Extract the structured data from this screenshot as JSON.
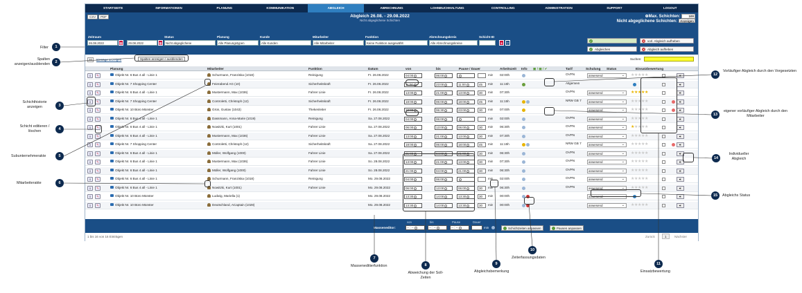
{
  "nav": {
    "items": [
      "STARTSEITE",
      "INFORMATIONEN",
      "PLANUNG",
      "KOMMUNIKATION",
      "ABGLEICH",
      "ABRECHNUNG",
      "LOHNBUCHHALTUNG",
      "CONTROLLING",
      "ADMINISTRATION",
      "SUPPORT",
      "LOGOUT"
    ],
    "active": "ABGLEICH"
  },
  "header": {
    "csv": "CSV",
    "pdf": "PDF",
    "title": "Abgleich 26.08. - 29.08.2022",
    "subtitle": "Nicht abgeglichene Schichten",
    "max_label": "Max. Schichten:",
    "max_value": "100",
    "open_label": "Nicht abgeglichene Schichten:",
    "open_btn": "Anzeigen"
  },
  "filters": {
    "labels": {
      "zeitraum": "Zeitraum",
      "status": "Status",
      "planung": "Planung",
      "kunde": "Kunde",
      "mitarbeiter": "Mitarbeiter",
      "funktion": "Funktion",
      "kreis": "Abrechnungskreis",
      "schicht_id": "Schicht-ID"
    },
    "date_from": "26.08.2022",
    "date_to": "29.08.2022",
    "status": "Nicht abgeglichene",
    "planung": "Alle Planungstypen",
    "kunde": "Alle Kunden",
    "mitarbeiter": "Alle Mitarbeiter",
    "funktion": "Keine Funktion ausgewählt",
    "kreis": "Alle Abrechnungskreise"
  },
  "actions": {
    "remove_prelim": "vorl. Abgleich aufheben",
    "confirm": "Abgleichen",
    "remove": "Abgleich aufheben"
  },
  "toolbar": {
    "entries": "20",
    "entries_label": "Einträge anzeigen",
    "columns_btn": "Spalten anzeigen / ausblenden",
    "search_label": "Suchen:"
  },
  "columns": {
    "planung": "Planung",
    "mitarbeiter": "Mitarbeiter",
    "funktion": "Funktion",
    "datum": "Datum",
    "von": "von",
    "bis": "bis",
    "pause": "Pause / Dauer",
    "az": "Arbeitszeit",
    "info": "Info",
    "tarif": "Tarif",
    "schulung": "Schulung",
    "status": "Status",
    "bewertung": "Einsatzbewertung"
  },
  "rows": [
    {
      "obj": "Objekt Nr. 6 Bus 4 all - Linie 1",
      "ma": "Schurmann, Franziska (1018)",
      "fn": "Reinigung",
      "dt": "Fr. 26.08.2022",
      "von": "04:00",
      "bis": "06:00",
      "pv": "",
      "pd": "",
      "az": "02:00h",
      "info": [
        "#9bb6d6"
      ],
      "tarif": "ÖVPN",
      "status": "anwesend",
      "stars": 0,
      "extra": ""
    },
    {
      "obj": "Objekt Nr. 7 Shopping Center",
      "ma": "Feierabend AG (10)",
      "fn": "Sicherheitskraft",
      "dt": "Fr. 26.08.2022",
      "von": "11:00",
      "bis": "23:00",
      "pv": "11:00",
      "pd": "45",
      "az": "11:15h",
      "info": [
        "#6a9e3d"
      ],
      "tarif": "Allgemein",
      "status": "",
      "stars": -1,
      "extra": "blue"
    },
    {
      "obj": "Objekt Nr. 6 Bus 4 all - Linie 1",
      "ma": "Mustermann, Max (1036)",
      "fn": "Fahrer Linie",
      "dt": "Fr. 26.08.2022",
      "von": "13:00",
      "bis": "21:00",
      "pv": "13:00",
      "pd": "30",
      "az": "07:30h",
      "info": [],
      "tarif": "ÖVPN",
      "status": "anwesend",
      "stars": 5,
      "extra": ""
    },
    {
      "obj": "Objekt Nr. 7 Shopping Center",
      "ma": "Controletti, Christoph (12)",
      "fn": "Sicherheitskraft",
      "dt": "Fr. 26.08.2022",
      "von": "18:00",
      "bis": "06:00",
      "pv": "18:00",
      "pd": "45",
      "az": "11:15h",
      "info": [
        "#e8b400",
        "#9bb6d6"
      ],
      "tarif": "NRW GB 7",
      "status": "anwesend",
      "stars": 0,
      "extra": "red"
    },
    {
      "obj": "Objekt Nr. 10 Büro Münster",
      "ma": "Grün, Gustav (1043)",
      "fn": "Thekenleiter",
      "dt": "Fr. 26.08.2022",
      "von": "23:00",
      "bis": "06:30",
      "pv": "23:00",
      "pd": "30",
      "az": "07:00h",
      "info": [
        "#e8b400"
      ],
      "tarif": "",
      "status": "anwesend",
      "stars": 0,
      "extra": "red"
    },
    {
      "obj": "Objekt Nr. 6 Bus 4 all - Linie 1",
      "ma": "Dassmann, Anna-Marie (1019)",
      "fn": "Reinigung",
      "dt": "Sa. 27.08.2022",
      "von": "04:00",
      "bis": "06:00",
      "pv": "",
      "pd": "",
      "az": "02:00h",
      "info": [
        "#9bb6d6"
      ],
      "tarif": "ÖVPN",
      "status": "anwesend",
      "stars": 0,
      "extra": ""
    },
    {
      "obj": "Objekt Nr. 6 Bus 4 all - Linie 1",
      "ma": "Nowitzki, Kurt (1001)",
      "fn": "Fahrer Linie",
      "dt": "Sa. 27.08.2022",
      "von": "06:00",
      "bis": "13:00",
      "pv": "06:00",
      "pd": "30",
      "az": "06:30h",
      "info": [
        "#9bb6d6"
      ],
      "tarif": "ÖVPN",
      "status": "anwesend",
      "stars": 1,
      "extra": ""
    },
    {
      "obj": "Objekt Nr. 6 Bus 4 all - Linie 1",
      "ma": "Mustermann, Max (1036)",
      "fn": "Fahrer Linie",
      "dt": "Sa. 27.08.2022",
      "von": "13:00",
      "bis": "21:00",
      "pv": "13:00",
      "pd": "30",
      "az": "07:30h",
      "info": [
        "#9bb6d6"
      ],
      "tarif": "ÖVPN",
      "status": "anwesend",
      "stars": 0,
      "extra": ""
    },
    {
      "obj": "Objekt Nr. 7 Shopping Center",
      "ma": "Controletti, Christoph (12)",
      "fn": "Sicherheitskraft",
      "dt": "Sa. 27.08.2022",
      "von": "18:00",
      "bis": "06:00",
      "pv": "18:00",
      "pd": "45",
      "az": "11:15h",
      "info": [
        "#e8b400",
        "#9bb6d6"
      ],
      "tarif": "NRW GB 7",
      "status": "anwesend",
      "stars": 0,
      "extra": "red"
    },
    {
      "obj": "Objekt Nr. 6 Bus 4 all - Linie 1",
      "ma": "Müller, Wolfgang (1000)",
      "fn": "Fahrer Linie",
      "dt": "Sa. 27.08.2022",
      "von": "21:00",
      "bis": "04:00",
      "pv": "21:00",
      "pd": "30",
      "az": "06:30h",
      "info": [
        "#9bb6d6"
      ],
      "tarif": "ÖVPN",
      "status": "anwesend",
      "stars": 0,
      "extra": ""
    },
    {
      "obj": "Objekt Nr. 6 Bus 4 all - Linie 1",
      "ma": "Mustermann, Max (1036)",
      "fn": "Fahrer Linie",
      "dt": "So. 28.08.2022",
      "von": "13:00",
      "bis": "21:00",
      "pv": "13:00",
      "pd": "30",
      "az": "07:30h",
      "info": [
        "#9bb6d6"
      ],
      "tarif": "ÖVPN",
      "status": "anwesend",
      "stars": 0,
      "extra": ""
    },
    {
      "obj": "Objekt Nr. 6 Bus 4 all - Linie 1",
      "ma": "Müller, Wolfgang (1000)",
      "fn": "Fahrer Linie",
      "dt": "So. 28.08.2022",
      "von": "21:00",
      "bis": "04:00",
      "pv": "21:00",
      "pd": "30",
      "az": "06:30h",
      "info": [
        "#9bb6d6"
      ],
      "tarif": "ÖVPN",
      "status": "anwesend",
      "stars": 0,
      "extra": ""
    },
    {
      "obj": "Objekt Nr. 6 Bus 4 all - Linie 1",
      "ma": "Schurmann, Franziska (1018)",
      "fn": "Reinigung",
      "dt": "Mo. 29.08.2022",
      "von": "04:00",
      "bis": "06:00",
      "pv": "",
      "pd": "",
      "az": "02:00h",
      "info": [
        "#9bb6d6"
      ],
      "tarif": "ÖVPN",
      "status": "anwesend",
      "stars": 0,
      "extra": ""
    },
    {
      "obj": "Objekt Nr. 6 Bus 4 all - Linie 1",
      "ma": "Nowitzki, Kurt (1001)",
      "fn": "Fahrer Linie",
      "dt": "Mo. 29.08.2022",
      "von": "06:00",
      "bis": "13:00",
      "pv": "06:00",
      "pd": "30",
      "az": "06:30h",
      "info": [
        "#9bb6d6"
      ],
      "tarif": "ÖVPN",
      "status": "anwesend",
      "stars": 0,
      "extra": ""
    },
    {
      "obj": "Objekt Nr. 10 Büro Münster",
      "ma": "Ludwig, Mariella (1)",
      "fn": "",
      "dt": "Mo. 29.08.2022",
      "von": "13:30",
      "bis": "14:00",
      "pv": "13:30",
      "pd": "30",
      "az": "00:00h",
      "info": [
        "#9bb6d6",
        "#c33"
      ],
      "tarif": "",
      "status": "anwesend",
      "stars": -1,
      "extra": "blue"
    },
    {
      "obj": "Objekt Nr. 10 Büro Münster",
      "ma": "Deutschland, ACaptain (1028)",
      "fn": "",
      "dt": "Mo. 29.08.2022",
      "von": "13:30",
      "bis": "14:00",
      "pv": "13:30",
      "pd": "30",
      "az": "00:00h",
      "info": [
        "#9bb6d6",
        "#c33"
      ],
      "tarif": "",
      "status": "anwesend",
      "stars": 0,
      "extra": ""
    }
  ],
  "mass": {
    "label": "Masseneditor:",
    "von": "von",
    "bis": "bis",
    "pause": "Pause",
    "dauer": "Dauer",
    "min": "min",
    "btn1": "Schichtzeiten anpassen",
    "btn2": "Pausen anpassen"
  },
  "footer": {
    "info": "1 bis 16 von 16 Einträgen",
    "prev": "Zurück",
    "page": "1",
    "next": "Nächster"
  },
  "callouts": [
    {
      "n": "1",
      "label": "Filter"
    },
    {
      "n": "2",
      "label": "Spalten anzeigen/ausblenden"
    },
    {
      "n": "3",
      "label": "Schichthistorie anzeigen"
    },
    {
      "n": "4",
      "label": "Schicht editieren / löschen"
    },
    {
      "n": "5",
      "label": "Subunternehmerakte"
    },
    {
      "n": "6",
      "label": "Mitarbeiterakte"
    },
    {
      "n": "7",
      "label": "Masseneditierfunktion"
    },
    {
      "n": "8",
      "label": "Abweichung der Soll- Zeiten"
    },
    {
      "n": "9",
      "label": "Abgleichsbemerkung"
    },
    {
      "n": "10",
      "label": "Zeiterfassungsdaten"
    },
    {
      "n": "11",
      "label": "Einsatzbewertung"
    },
    {
      "n": "12",
      "label": "Vorläufiger Abgleich durch den Vorgesetzten"
    },
    {
      "n": "13",
      "label": "eigener vorläufiger Abgleich durch den Mitarbeiter"
    },
    {
      "n": "14",
      "label": "Individueller Abgleich"
    },
    {
      "n": "15",
      "label": "Abgleichs Status"
    }
  ]
}
